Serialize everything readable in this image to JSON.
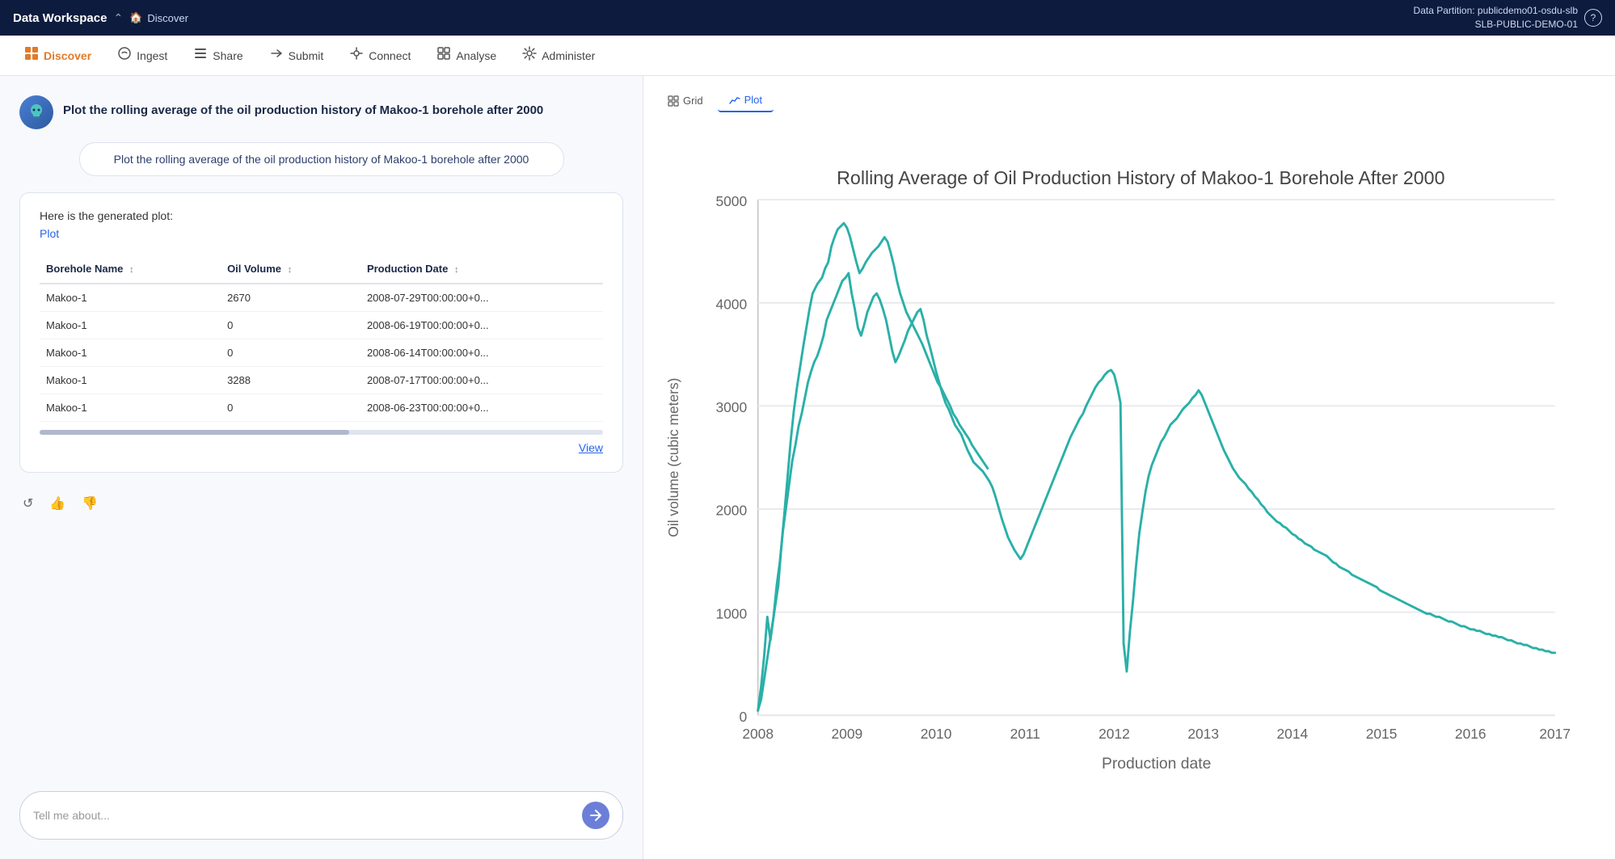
{
  "topbar": {
    "title": "Data Workspace",
    "breadcrumb_separator": "⌃",
    "home_icon": "🏠",
    "breadcrumb_label": "Discover",
    "partition_label": "Data Partition: publicdemo01-osdu-slb",
    "partition_sub": "SLB-PUBLIC-DEMO-01",
    "help_icon": "?"
  },
  "navbar": {
    "items": [
      {
        "id": "discover",
        "label": "Discover",
        "icon": "⊞",
        "active": true
      },
      {
        "id": "ingest",
        "label": "Ingest",
        "icon": "↗",
        "active": false
      },
      {
        "id": "share",
        "label": "Share",
        "icon": "≡",
        "active": false
      },
      {
        "id": "submit",
        "label": "Submit",
        "icon": "⊣",
        "active": false
      },
      {
        "id": "connect",
        "label": "Connect",
        "icon": "⟳",
        "active": false
      },
      {
        "id": "analyse",
        "label": "Analyse",
        "icon": "▦",
        "active": false
      },
      {
        "id": "administer",
        "label": "Administer",
        "icon": "⚙",
        "active": false
      }
    ]
  },
  "chat": {
    "query_title": "Plot the rolling average of the oil production history of Makoo-1 borehole after 2000",
    "user_message": "Plot the rolling average of the oil production history of Makoo-1 borehole after 2000",
    "response_intro": "Here is the generated plot:",
    "plot_link": "Plot",
    "view_link": "View",
    "table": {
      "columns": [
        {
          "id": "borehole",
          "label": "Borehole Name",
          "sortable": true
        },
        {
          "id": "volume",
          "label": "Oil Volume",
          "sortable": true
        },
        {
          "id": "date",
          "label": "Production Date",
          "sortable": true
        }
      ],
      "rows": [
        {
          "borehole": "Makoo-1",
          "volume": "2670",
          "date": "2008-07-29T00:00:00+0..."
        },
        {
          "borehole": "Makoo-1",
          "volume": "0",
          "date": "2008-06-19T00:00:00+0..."
        },
        {
          "borehole": "Makoo-1",
          "volume": "0",
          "date": "2008-06-14T00:00:00+0..."
        },
        {
          "borehole": "Makoo-1",
          "volume": "3288",
          "date": "2008-07-17T00:00:00+0..."
        },
        {
          "borehole": "Makoo-1",
          "volume": "0",
          "date": "2008-06-23T00:00:00+0..."
        }
      ]
    }
  },
  "input_placeholder": "Tell me about...",
  "chart": {
    "grid_label": "Grid",
    "plot_label": "Plot",
    "title": "Rolling Average of Oil Production History of Makoo-1 Borehole After 2000",
    "x_axis_label": "Production date",
    "y_axis_label": "Oil volume (cubic meters)",
    "y_ticks": [
      "0",
      "1000",
      "2000",
      "3000",
      "4000",
      "5000"
    ],
    "x_ticks": [
      "2008",
      "2009",
      "2010",
      "2011",
      "2012",
      "2013",
      "2014",
      "2015",
      "2016",
      "2017"
    ]
  },
  "actions": {
    "refresh_icon": "↺",
    "thumb_up_icon": "👍",
    "thumb_down_icon": "👎"
  }
}
